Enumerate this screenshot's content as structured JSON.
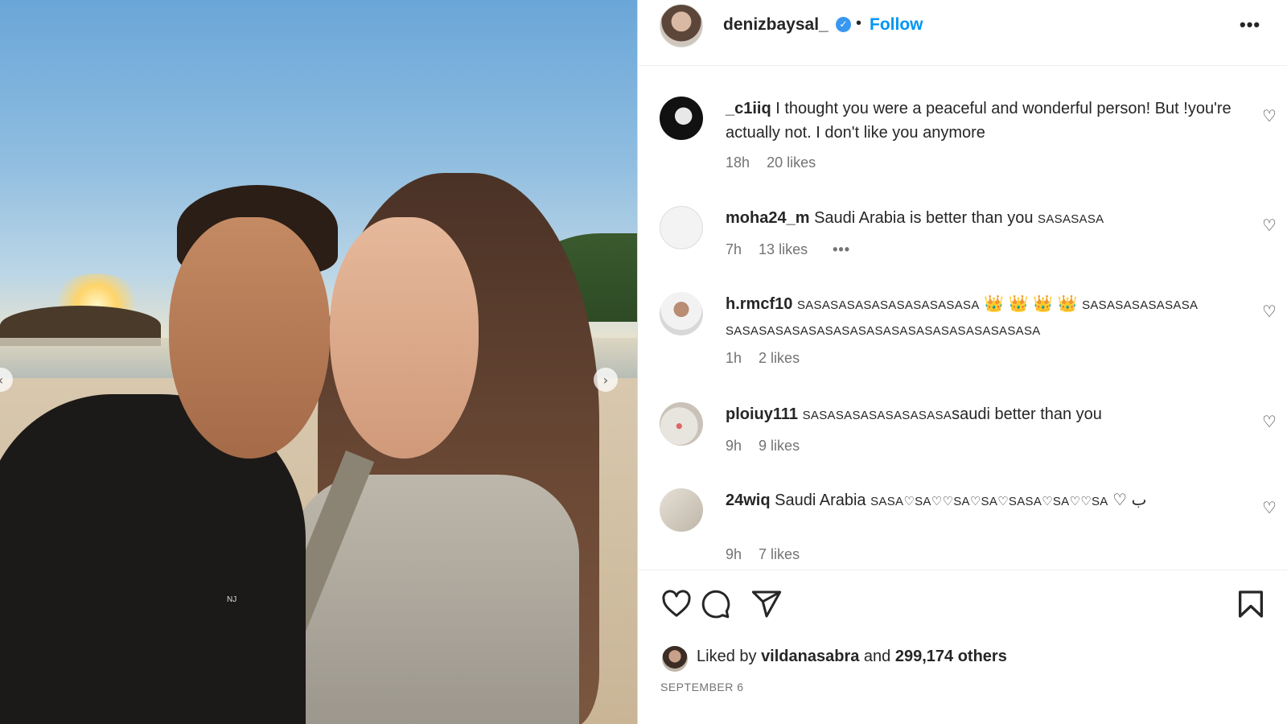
{
  "post": {
    "username": "denizbaysal_",
    "follow_label": "Follow",
    "separator": "•",
    "more_label": "•••",
    "verified_glyph": "✓",
    "shirt_text": "NJ"
  },
  "photo_nav": {
    "prev": "‹",
    "next": "›"
  },
  "comments": [
    {
      "user": "_c1iiq",
      "text": "I thought you were a peaceful and wonderful person! But !you're actually not. I don't like you anymore",
      "time": "18h",
      "likes": "20 likes"
    },
    {
      "user": "moha24_m",
      "text": "Saudi Arabia is better than you",
      "caps": "SASASASA",
      "time": "7h",
      "likes": "13 likes",
      "more": "•••"
    },
    {
      "user": "h.rmcf10",
      "caps": "SASASASASASASASASASASA",
      "emoji": "👑 👑 👑 👑",
      "caps2": "SASASASASASASA",
      "caps3": "SASASASASASASASASASASASASASASASASASASA",
      "time": "1h",
      "likes": "2 likes"
    },
    {
      "user": "ploiuy111",
      "caps": "SASASASASASASASASA",
      "text": "saudi better than you",
      "time": "9h",
      "likes": "9 likes"
    },
    {
      "user": "24wiq",
      "text": "Saudi Arabia",
      "caps_sequence": "SASA♡SA♡♡SA♡SA♡SASA♡SA♡♡SA",
      "tail": "♡ ب",
      "time": "9h",
      "likes": "7 likes"
    }
  ],
  "like_glyph": "♡",
  "footer": {
    "liked_prefix": "Liked by",
    "liked_user": "vildanasabra",
    "liked_and": "and",
    "liked_others": "299,174 others",
    "date": "SEPTEMBER 6"
  },
  "icons": [
    "heart-icon",
    "comment-icon",
    "share-icon",
    "bookmark-icon",
    "verified-icon",
    "more-icon"
  ],
  "colors": {
    "accent": "#0095f6",
    "verified": "#3897f0",
    "text": "#262626",
    "muted": "#737373"
  }
}
